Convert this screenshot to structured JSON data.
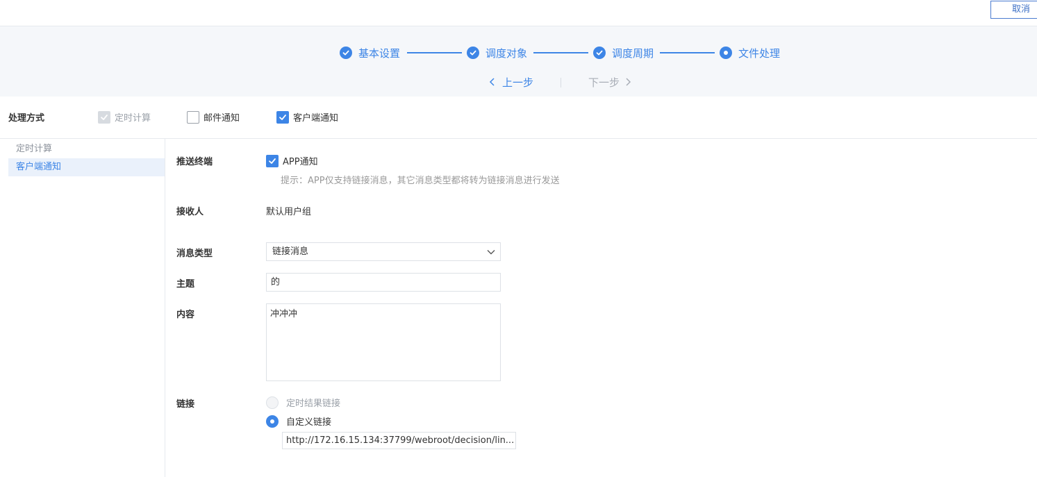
{
  "header": {
    "cancel_label": "取消"
  },
  "steps": [
    {
      "label": "基本设置",
      "state": "done"
    },
    {
      "label": "调度对象",
      "state": "done"
    },
    {
      "label": "调度周期",
      "state": "done"
    },
    {
      "label": "文件处理",
      "state": "current"
    }
  ],
  "nav": {
    "prev_label": "上一步",
    "next_label": "下一步"
  },
  "method": {
    "label": "处理方式",
    "options": [
      {
        "label": "定时计算",
        "checked": true,
        "disabled": true
      },
      {
        "label": "邮件通知",
        "checked": false,
        "disabled": false
      },
      {
        "label": "客户端通知",
        "checked": true,
        "disabled": false
      }
    ]
  },
  "sidebar": {
    "items": [
      {
        "label": "定时计算",
        "active": false
      },
      {
        "label": "客户端通知",
        "active": true
      }
    ]
  },
  "form": {
    "push_terminal": {
      "label": "推送终端",
      "option_label": "APP通知",
      "checked": true,
      "hint": "提示：APP仅支持链接消息，其它消息类型都将转为链接消息进行发送"
    },
    "receiver": {
      "label": "接收人",
      "value": "默认用户组"
    },
    "message_type": {
      "label": "消息类型",
      "value": "链接消息"
    },
    "subject": {
      "label": "主题",
      "value": "的"
    },
    "content": {
      "label": "内容",
      "value": "冲冲冲"
    },
    "link": {
      "label": "链接",
      "options": [
        {
          "label": "定时结果链接",
          "selected": false,
          "disabled": true
        },
        {
          "label": "自定义链接",
          "selected": true,
          "disabled": false
        }
      ],
      "custom_url": "http://172.16.15.134:37799/webroot/decision/lin..."
    }
  },
  "colors": {
    "accent": "#3d85e6",
    "muted": "#9aa0a8",
    "border": "#dde1e6",
    "panel": "#f5f7fa"
  }
}
